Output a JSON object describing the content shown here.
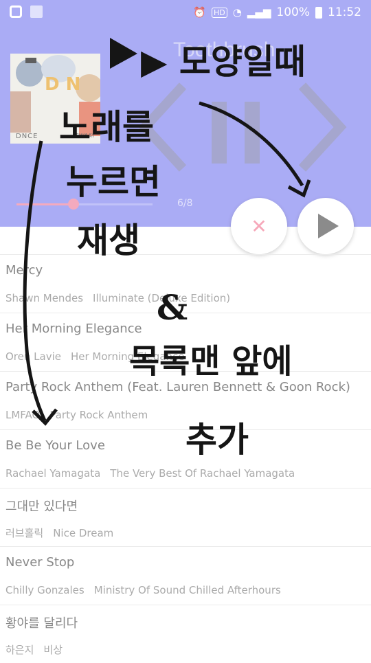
{
  "status_bar": {
    "battery": "100%",
    "time": "11:52",
    "hd": "HD"
  },
  "player": {
    "title": "Toothbrush",
    "counter": "6/8",
    "progress_fraction": 0.42,
    "album": {
      "art_label": "DNCE",
      "art_sub": "SWAAY",
      "letters": "D N"
    }
  },
  "songs": [
    {
      "title": "Mercy",
      "artist": "Shawn Mendes",
      "album": "Illuminate (Deluxe Edition)"
    },
    {
      "title": "Her Morning Elegance",
      "artist": "Oren Lavie",
      "album": "Her Morning Elegance"
    },
    {
      "title": "Party Rock Anthem (Feat. Lauren Bennett & Goon Rock)",
      "artist": "LMFAO",
      "album": "Party Rock Anthem"
    },
    {
      "title": "Be Be Your Love",
      "artist": "Rachael Yamagata",
      "album": "The Very Best Of Rachael Yamagata"
    },
    {
      "title": "그대만 있다면",
      "artist": "러브홀릭",
      "album": "Nice Dream"
    },
    {
      "title": "Never Stop",
      "artist": "Chilly Gonzales",
      "album": "Ministry Of Sound Chilled Afterhours"
    },
    {
      "title": "황야를 달리다",
      "artist": "하은지",
      "album": "비상"
    }
  ],
  "annotations": {
    "play_shape": "▶ 모양일때",
    "line1": "노래를",
    "line2": "누르면",
    "line3": "재생",
    "amp": "&",
    "line5": "목록맨 앞에",
    "line6": "추가"
  },
  "colors": {
    "header_bg": "#8a8cf2",
    "accent_pink": "#f08aa6"
  },
  "icons": {
    "close": "close-icon",
    "play": "play-icon",
    "prev": "prev-icon",
    "pause": "pause-icon",
    "next": "next-icon"
  }
}
